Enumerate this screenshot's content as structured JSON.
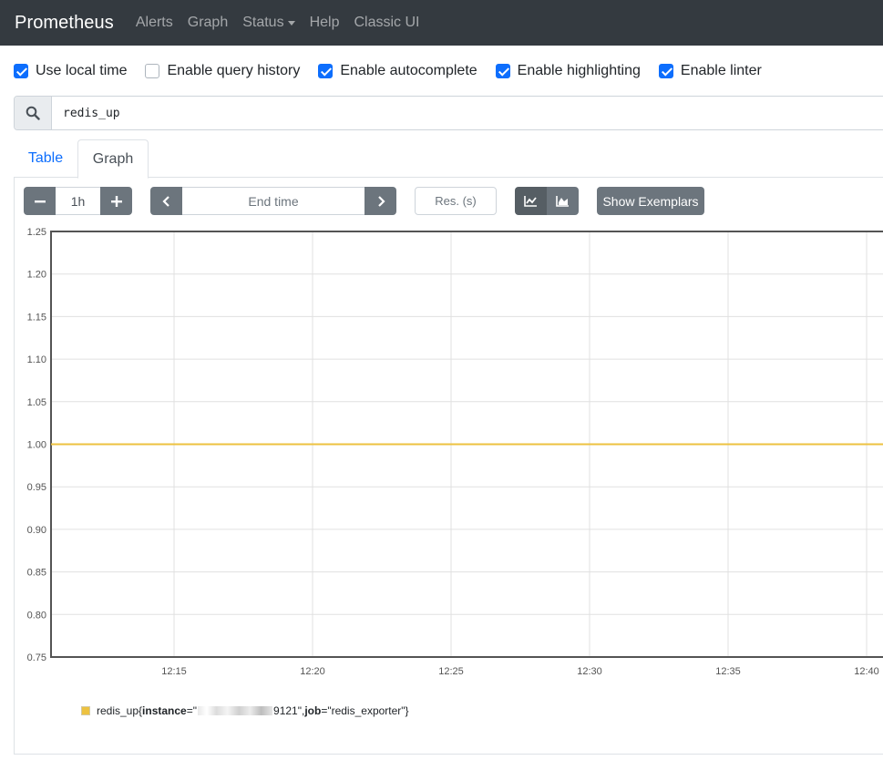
{
  "navbar": {
    "brand": "Prometheus",
    "items": [
      "Alerts",
      "Graph",
      "Status",
      "Help",
      "Classic UI"
    ]
  },
  "options": [
    {
      "label": "Use local time",
      "checked": true
    },
    {
      "label": "Enable query history",
      "checked": false
    },
    {
      "label": "Enable autocomplete",
      "checked": true
    },
    {
      "label": "Enable highlighting",
      "checked": true
    },
    {
      "label": "Enable linter",
      "checked": true
    }
  ],
  "query": {
    "value": "redis_up"
  },
  "tabs": [
    "Table",
    "Graph"
  ],
  "controls": {
    "range": "1h",
    "end_time_placeholder": "End time",
    "resolution_placeholder": "Res. (s)",
    "show_exemplars": "Show Exemplars"
  },
  "chart_data": {
    "type": "line",
    "ylim": [
      0.75,
      1.25
    ],
    "yticks": [
      "1.25",
      "1.20",
      "1.15",
      "1.10",
      "1.05",
      "1.00",
      "0.95",
      "0.90",
      "0.85",
      "0.80",
      "0.75"
    ],
    "xticks": [
      "12:15",
      "12:20",
      "12:25",
      "12:30",
      "12:35",
      "12:40"
    ],
    "series": [
      {
        "name": "redis_up",
        "color": "#edc240",
        "values": [
          1,
          1,
          1,
          1,
          1,
          1
        ]
      }
    ]
  },
  "legend": {
    "metric": "redis_up",
    "open_brace": "{",
    "instance_key": "instance",
    "instance_eq": "=\"",
    "instance_suffix": "9121\", ",
    "job_key": "job",
    "job_value": "=\"redis_exporter\"}"
  }
}
